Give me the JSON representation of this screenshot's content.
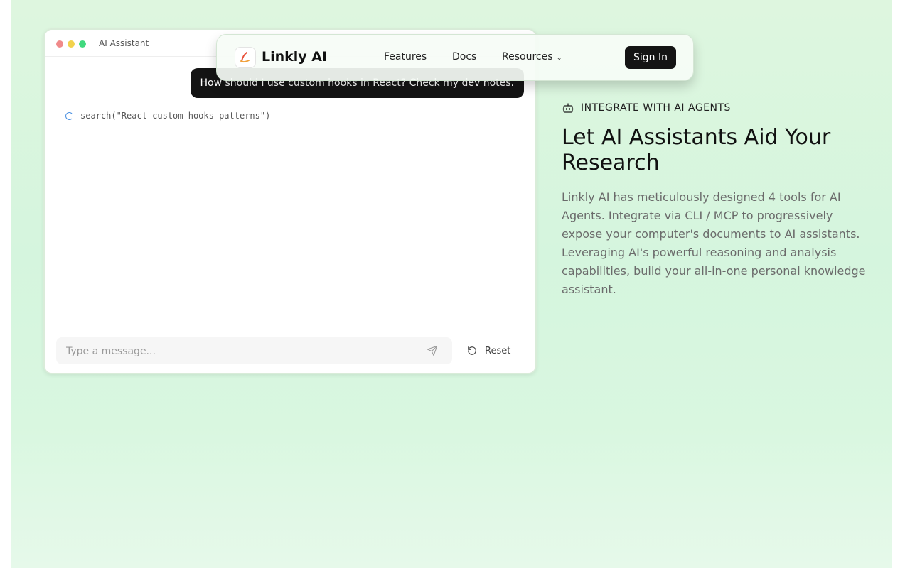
{
  "colors": {
    "background_green": "#d7f5df",
    "dark_button": "#141414",
    "traffic_red": "#f08a8a",
    "traffic_yellow": "#f2d24d",
    "traffic_green": "#40d97e",
    "spinner_blue": "#4a90e2"
  },
  "chat": {
    "window_title": "AI Assistant",
    "user_message": "How should I use custom hooks in React? Check my dev notes.",
    "tool_call": "search(\"React custom hooks patterns\")",
    "input_placeholder": "Type a message...",
    "send_icon": "send-icon",
    "reset_label": "Reset",
    "reset_icon": "refresh-icon"
  },
  "navbar": {
    "brand": "Linkly AI",
    "links": {
      "features": "Features",
      "docs": "Docs",
      "resources": "Resources"
    },
    "signin_label": "Sign In"
  },
  "section": {
    "eyebrow": "INTEGRATE WITH AI AGENTS",
    "eyebrow_icon": "robot-icon",
    "headline": "Let AI Assistants Aid Your Research",
    "description": "Linkly AI has meticulously designed 4 tools for AI Agents. Integrate via CLI / MCP to progressively expose your computer's documents to AI assistants. Leveraging AI's powerful reasoning and analysis capabilities, build your all-in-one personal knowledge assistant."
  }
}
